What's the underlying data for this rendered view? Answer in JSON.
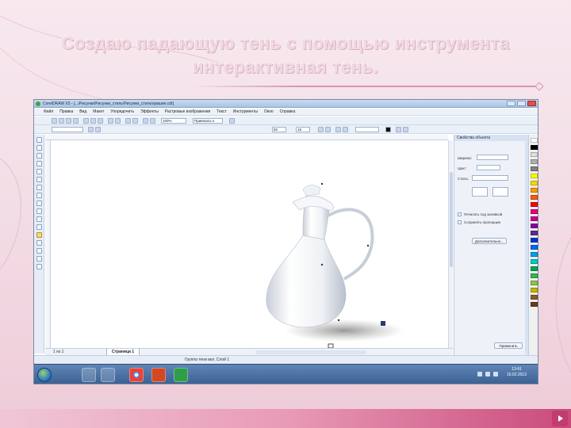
{
  "slide": {
    "title_line1": "Создаю падающую тень с помощью инструмента",
    "title_line2": "интерактивная тень."
  },
  "window": {
    "title": "CorelDRAW X5 - [...\\Рисунки\\Рисунки_стиль\\Рисунки_стиль\\кувшин.cdr]"
  },
  "menu": [
    "Файл",
    "Правка",
    "Вид",
    "Макет",
    "Упорядочить",
    "Эффекты",
    "Растровые изображения",
    "Текст",
    "Инструменты",
    "Окно",
    "Справка"
  ],
  "toolbar": {
    "zoom": "100%",
    "snap": "Привязать к",
    "width_field": "",
    "shadow_opacity": "50",
    "shadow_feather": "15",
    "shadow_color_field": ""
  },
  "docker": {
    "title": "Свойства объекта",
    "width_label": "Ширина:",
    "color_label": "Цвет:",
    "style_label": "Стиль:",
    "behind_fill_label": "Печатать под заливкой",
    "scale_with_image_label": "Сохранять пропорции",
    "more_button": "Дополнительно...",
    "apply_button": "Применить"
  },
  "pagebar": {
    "page_count": "1 из 1",
    "page_tab": "Страница 1"
  },
  "status": {
    "text": "Группа тени вкл. Слой 1"
  },
  "taskbar": {
    "time": "13:41",
    "date": "16.02.2013"
  },
  "colors": {
    "accent": "#d895b2",
    "selected_tool": "#f7d774",
    "taskbar": "#3a5f92",
    "handle": "#2a3a6e"
  },
  "palette": [
    "#ffffff",
    "#000000",
    "#e0e0e0",
    "#b0b0b0",
    "#808080",
    "#ffff00",
    "#ffd700",
    "#ff9900",
    "#ff5a00",
    "#ff0000",
    "#e6007e",
    "#c8008c",
    "#8b00a0",
    "#5a2d8c",
    "#0033cc",
    "#0066ff",
    "#00a0e6",
    "#00c8c8",
    "#00a651",
    "#39b54a",
    "#8cc63f",
    "#c8b400",
    "#8b5a2b",
    "#6b3a1e"
  ],
  "icons": {
    "start": "windows-start-icon",
    "explorer": "folder-icon",
    "chrome": "chrome-icon",
    "ppt": "powerpoint-icon",
    "corel": "coreldraw-icon"
  }
}
